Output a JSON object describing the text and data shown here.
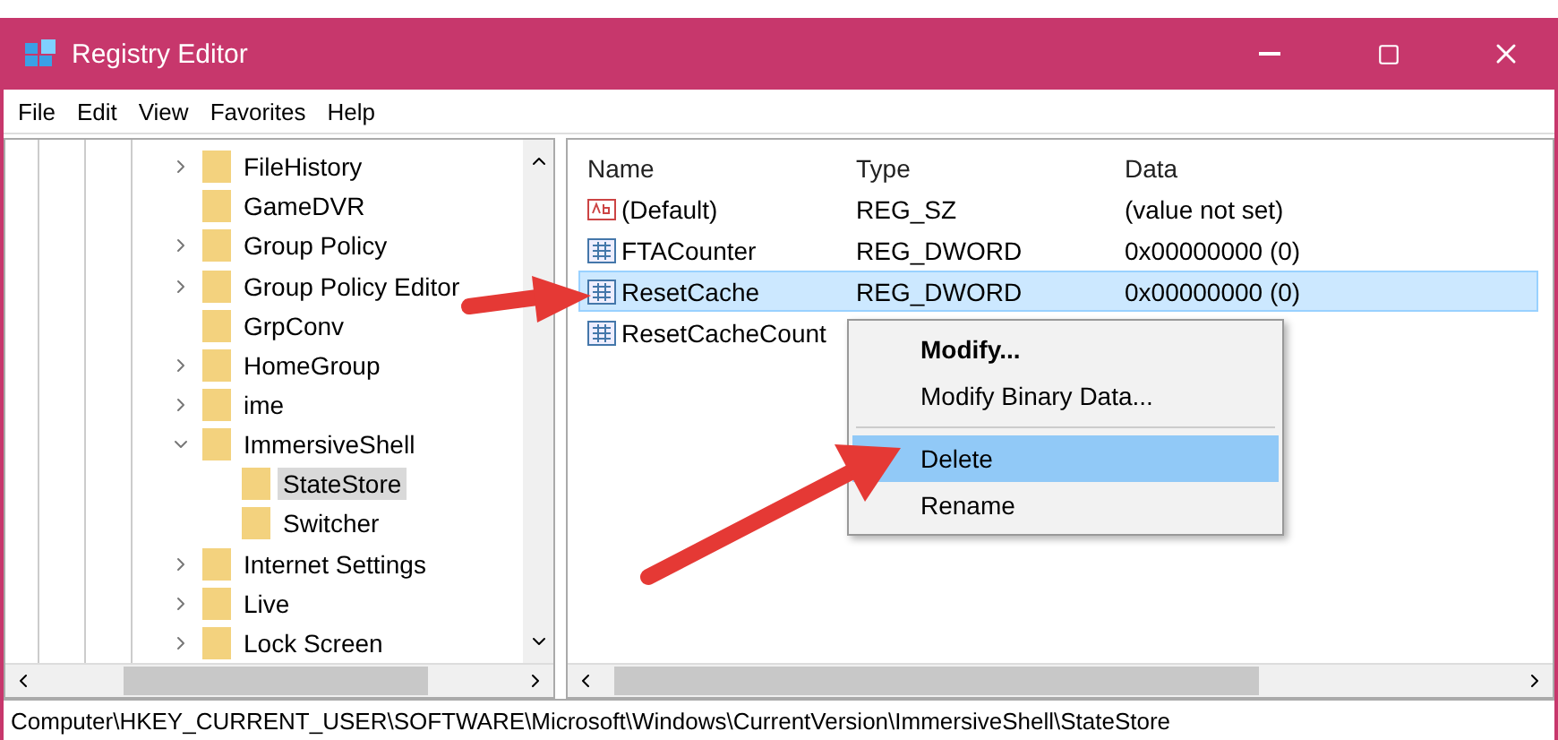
{
  "window": {
    "title": "Registry Editor"
  },
  "menu_bar": [
    "File",
    "Edit",
    "View",
    "Favorites",
    "Help"
  ],
  "tree": {
    "items": [
      {
        "label": "FileHistory",
        "expanded": false,
        "selected": false
      },
      {
        "label": "GameDVR",
        "selected": false
      },
      {
        "label": "Group Policy",
        "expanded": false,
        "selected": false
      },
      {
        "label": "Group Policy Editor",
        "expanded": false,
        "selected": false
      },
      {
        "label": "GrpConv",
        "selected": false
      },
      {
        "label": "HomeGroup",
        "expanded": false,
        "selected": false
      },
      {
        "label": "ime",
        "expanded": false,
        "selected": false
      },
      {
        "label": "ImmersiveShell",
        "expanded": true,
        "selected": false,
        "children": [
          {
            "label": "StateStore",
            "selected": true
          },
          {
            "label": "Switcher",
            "selected": false
          }
        ]
      },
      {
        "label": "Internet Settings",
        "expanded": false,
        "selected": false
      },
      {
        "label": "Live",
        "expanded": false,
        "selected": false
      },
      {
        "label": "Lock Screen",
        "expanded": false,
        "selected": false
      }
    ]
  },
  "values": {
    "columns": [
      "Name",
      "Type",
      "Data"
    ],
    "rows": [
      {
        "kind": "string",
        "name": "(Default)",
        "type": "REG_SZ",
        "data": "(value not set)",
        "selected": false
      },
      {
        "kind": "binary",
        "name": "FTACounter",
        "type": "REG_DWORD",
        "data": "0x00000000 (0)",
        "selected": false
      },
      {
        "kind": "binary",
        "name": "ResetCache",
        "type": "REG_DWORD",
        "data": "0x00000000 (0)",
        "selected": true
      },
      {
        "kind": "binary",
        "name": "ResetCacheCount",
        "selected": false
      }
    ]
  },
  "context_menu": [
    {
      "kind": "item",
      "label": "Modify...",
      "bold": true,
      "selected": false
    },
    {
      "kind": "item",
      "label": "Modify Binary Data...",
      "bold": false,
      "selected": false
    },
    {
      "kind": "separator"
    },
    {
      "kind": "item",
      "label": "Delete",
      "bold": false,
      "selected": true
    },
    {
      "kind": "item",
      "label": "Rename",
      "bold": false,
      "selected": false
    }
  ],
  "status_bar": "Computer\\HKEY_CURRENT_USER\\SOFTWARE\\Microsoft\\Windows\\CurrentVersion\\ImmersiveShell\\StateStore"
}
